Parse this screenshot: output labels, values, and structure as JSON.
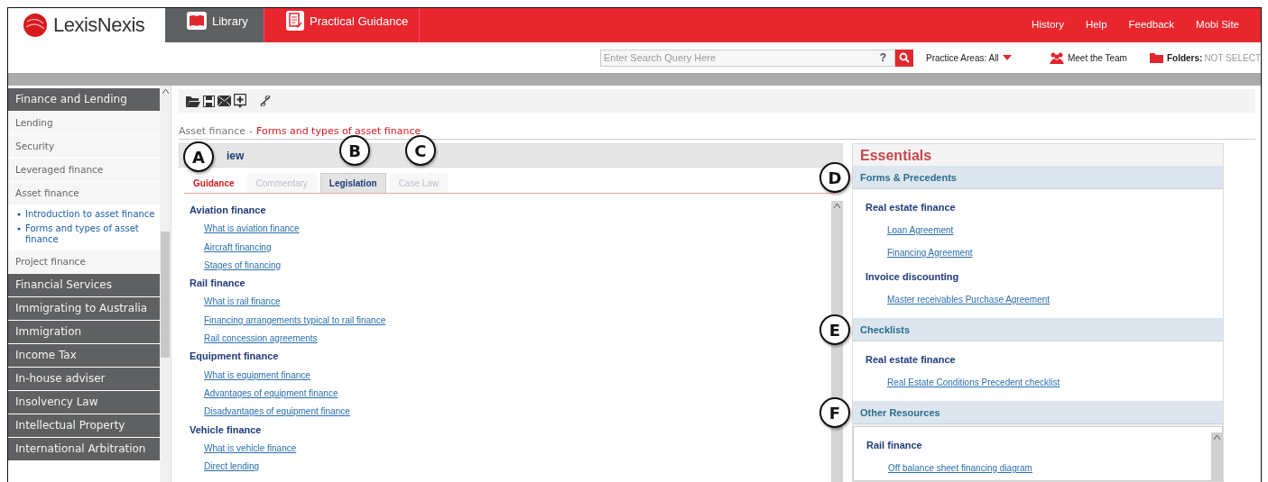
{
  "header": {
    "logo": "LexisNexis",
    "nav_tabs": [
      {
        "label": "Library",
        "selected": true
      },
      {
        "label": "Practical Guidance",
        "selected": false
      }
    ],
    "links": [
      "History",
      "Help",
      "Feedback",
      "Mobi Site"
    ]
  },
  "search": {
    "placeholder": "Enter Search Query Here",
    "help": "?",
    "practice_areas": "Practice Areas: All",
    "meet_team": "Meet the Team",
    "folders_label": "Folders:",
    "folders_value": "NOT SELECT"
  },
  "sidebar": {
    "items": [
      {
        "label": "Finance and Lending",
        "children": [
          {
            "label": "Lending"
          },
          {
            "label": "Security"
          },
          {
            "label": "Leveraged finance"
          },
          {
            "label": "Asset finance",
            "children": [
              {
                "label": "Introduction to asset finance"
              },
              {
                "label": "Forms and types of asset finance"
              }
            ]
          },
          {
            "label": "Project finance"
          }
        ]
      },
      {
        "label": "Financial Services"
      },
      {
        "label": "Immigrating to Australia"
      },
      {
        "label": "Immigration"
      },
      {
        "label": "Income Tax"
      },
      {
        "label": "In-house adviser"
      },
      {
        "label": "Insolvency Law"
      },
      {
        "label": "Intellectual Property"
      },
      {
        "label": "International Arbitration"
      }
    ]
  },
  "breadcrumb": {
    "parent": "Asset finance",
    "separator": "-",
    "current": "Forms and types of asset finance"
  },
  "overview": {
    "title": "iew",
    "callout": "A",
    "tabs": [
      {
        "label": "Guidance",
        "selected": true,
        "disabled": false
      },
      {
        "label": "Commentary",
        "selected": false,
        "disabled": true
      },
      {
        "label": "Legislation",
        "selected": false,
        "disabled": false,
        "callout": "B"
      },
      {
        "label": "Case Law",
        "selected": false,
        "disabled": true,
        "callout": "C"
      }
    ],
    "groups": [
      {
        "heading": "Aviation finance",
        "links": [
          "What is aviation finance",
          "Aircraft financing",
          "Stages of financing"
        ]
      },
      {
        "heading": "Rail finance",
        "links": [
          "What is rail finance",
          "Financing arrangements typical to rail finance",
          "Rail concession agreements"
        ]
      },
      {
        "heading": "Equipment finance",
        "links": [
          "What is equipment finance",
          "Advantages of equipment finance",
          "Disadvantages of equipment finance"
        ]
      },
      {
        "heading": "Vehicle finance",
        "links": [
          "What is vehicle finance",
          "Direct lending"
        ]
      }
    ]
  },
  "essentials": {
    "title": "Essentials",
    "sections": [
      {
        "title": "Forms & Precedents",
        "callout": "D",
        "groups": [
          {
            "heading": "Real estate finance",
            "links": [
              "Loan Agreement",
              "Financing Agreement"
            ]
          },
          {
            "heading": "Invoice discounting",
            "links": [
              "Master receivables Purchase Agreement"
            ]
          }
        ]
      },
      {
        "title": "Checklists",
        "callout": "E",
        "groups": [
          {
            "heading": "Real estate finance",
            "links": [
              "Real Estate Conditions Precedent checklist"
            ]
          }
        ]
      },
      {
        "title": "Other Resources",
        "callout": "F",
        "groups": [
          {
            "heading": "Rail finance",
            "links": [
              "Off balance sheet financing diagram"
            ]
          }
        ]
      }
    ]
  }
}
